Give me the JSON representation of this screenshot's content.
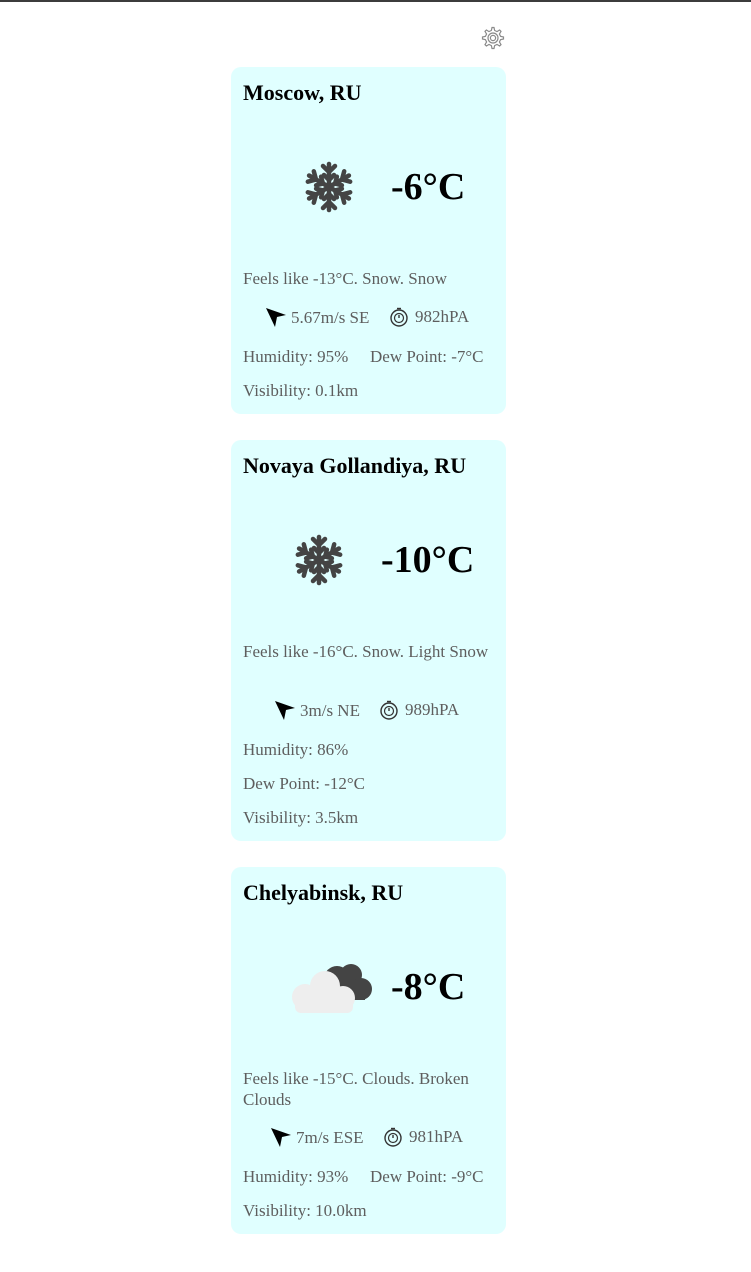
{
  "settings_icon": "gear-icon",
  "cards": [
    {
      "city": "Moscow, RU",
      "icon": "snowflake-icon",
      "temp": "-6°C",
      "feels": "Feels like -13°C. Snow. Snow",
      "wind": "5.67m/s SE",
      "pressure": "982hPA",
      "humidity": "Humidity: 95%",
      "dew": "Dew Point: -7°C",
      "visibility": "Visibility: 0.1km"
    },
    {
      "city": "Novaya Gollandiya, RU",
      "icon": "snowflake-icon",
      "temp": "-10°C",
      "feels": "Feels like -16°C. Snow. Light Snow",
      "wind": "3m/s NE",
      "pressure": "989hPA",
      "humidity": "Humidity: 86%",
      "dew": "Dew Point: -12°C",
      "visibility": "Visibility: 3.5km"
    },
    {
      "city": "Chelyabinsk, RU",
      "icon": "broken-clouds-icon",
      "temp": "-8°C",
      "feels": "Feels like -15°C. Clouds. Broken Clouds",
      "wind": "7m/s ESE",
      "pressure": "981hPA",
      "humidity": "Humidity: 93%",
      "dew": "Dew Point: -9°C",
      "visibility": "Visibility: 10.0km"
    }
  ]
}
